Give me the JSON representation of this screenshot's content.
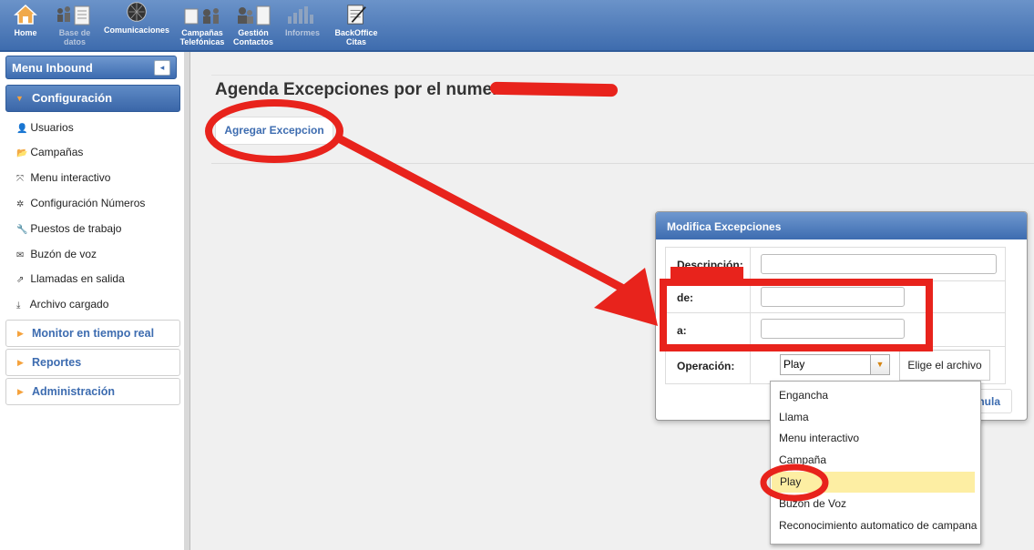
{
  "nav": {
    "items": [
      {
        "label": "Home",
        "icon": "home-icon"
      },
      {
        "label": "Base de\ndatos",
        "icon": "database-icon"
      },
      {
        "label": "Comunicaciones",
        "icon": "globe-icon"
      },
      {
        "label": "Campañas\nTelefónicas",
        "icon": "campaign-icon"
      },
      {
        "label": "Gestión\nContactos",
        "icon": "contacts-icon"
      },
      {
        "label": "Informes",
        "icon": "bar-chart-icon"
      },
      {
        "label": "BackOffice\nCitas",
        "icon": "notepad-icon"
      }
    ]
  },
  "sidebar": {
    "title": "Menu Inbound",
    "collapse_icon": "◂",
    "open_section": "Configuración",
    "items": [
      {
        "label": "Usuarios",
        "icon": "user-icon",
        "glyph": "👤"
      },
      {
        "label": "Campañas",
        "icon": "folder-icon",
        "glyph": "📂"
      },
      {
        "label": "Menu interactivo",
        "icon": "expand-icon",
        "glyph": "⤧"
      },
      {
        "label": "Configuración Números",
        "icon": "gear-icon",
        "glyph": "✲"
      },
      {
        "label": "Puestos de trabajo",
        "icon": "wrench-icon",
        "glyph": "🔧"
      },
      {
        "label": "Buzón de voz",
        "icon": "envelope-icon",
        "glyph": "✉"
      },
      {
        "label": "Llamadas en salida",
        "icon": "external-link-icon",
        "glyph": "⇗"
      },
      {
        "label": "Archivo cargado",
        "icon": "download-icon",
        "glyph": "⤓"
      }
    ],
    "sections": [
      "Monitor en tiempo real",
      "Reportes",
      "Administración"
    ]
  },
  "main": {
    "title": "Agenda Excepciones por el numero",
    "add_button": "Agregar Excepcion"
  },
  "dialog": {
    "title": "Modifica Excepciones",
    "labels": {
      "descripcion": "Descripción:",
      "de": "de:",
      "a": "a:",
      "operacion": "Operación:"
    },
    "operacion_selected": "Play",
    "file_button": "Elige el archivo",
    "cancel_button": "Anula"
  },
  "dropdown": {
    "options": [
      "Engancha",
      "Llama",
      "Menu interactivo",
      "Campaña",
      "Play",
      "Buzón de Voz",
      "Reconocimiento automatico de campana"
    ],
    "selected_index": 4
  },
  "colors": {
    "accent": "#3d6cb0",
    "annotation": "#e8231c",
    "highlight": "#fdeea3",
    "caret": "#f5a23c"
  }
}
